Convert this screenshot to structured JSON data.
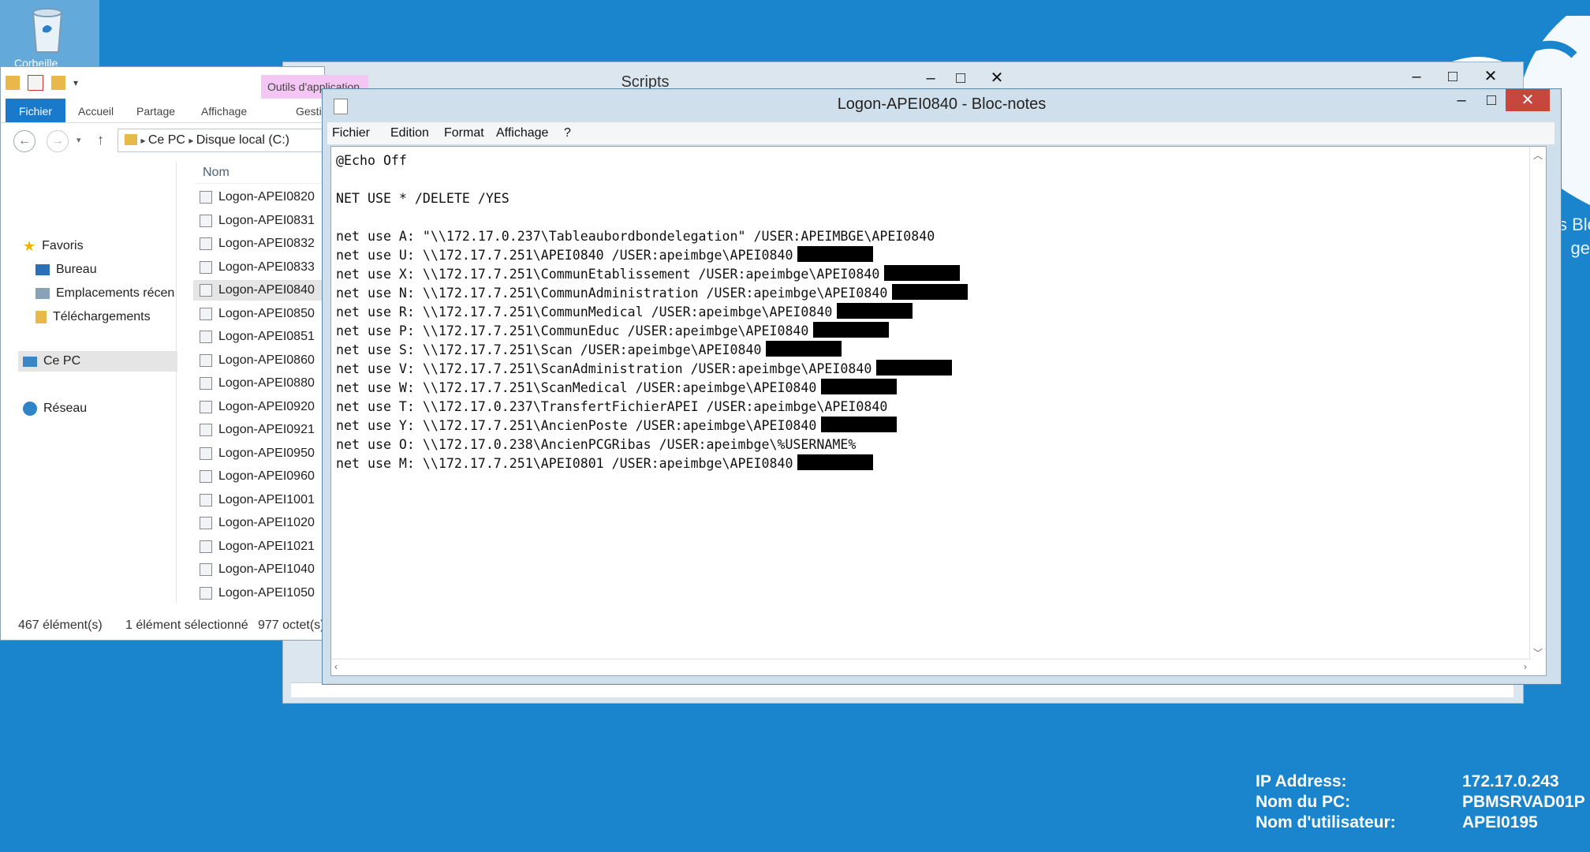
{
  "desktop": {
    "recycle_label": "Corbeille",
    "side_text": [
      "s Blo",
      "ge"
    ],
    "bginfo": [
      {
        "label": "IP Address:",
        "value": "172.17.0.243"
      },
      {
        "label": "Nom du PC:",
        "value": "PBMSRVAD01P"
      },
      {
        "label": "Nom d'utilisateur:",
        "value": "APEI0195"
      }
    ]
  },
  "explorer": {
    "contextual_tab": "Outils d'application",
    "tabs": [
      "Fichier",
      "Accueil",
      "Partage",
      "Affichage",
      "Gesti"
    ],
    "breadcrumb": [
      "Ce PC",
      "Disque local (C:)"
    ],
    "nav": {
      "favoris": "Favoris",
      "bureau": "Bureau",
      "emplacements": "Emplacements récen",
      "telechargements": "Téléchargements",
      "ce_pc": "Ce PC",
      "reseau": "Réseau"
    },
    "column_nom": "Nom",
    "files": [
      "Logon-APEI0820",
      "Logon-APEI0831",
      "Logon-APEI0832",
      "Logon-APEI0833",
      "Logon-APEI0840",
      "Logon-APEI0850",
      "Logon-APEI0851",
      "Logon-APEI0860",
      "Logon-APEI0880",
      "Logon-APEI0920",
      "Logon-APEI0921",
      "Logon-APEI0950",
      "Logon-APEI0960",
      "Logon-APEI1001",
      "Logon-APEI1020",
      "Logon-APEI1021",
      "Logon-APEI1040",
      "Logon-APEI1050"
    ],
    "selected_file": "Logon-APEI0840",
    "status": {
      "count": "467 élément(s)",
      "selection": "1 élément sélectionné",
      "size": "977 octet(s)"
    }
  },
  "scripts_window": {
    "title": "Scripts"
  },
  "notepad": {
    "title": "Logon-APEI0840 - Bloc-notes",
    "menu": [
      "Fichier",
      "Edition",
      "Format",
      "Affichage",
      "?"
    ],
    "lines": [
      {
        "text": "@Echo Off",
        "redacted": false
      },
      {
        "text": "",
        "redacted": false
      },
      {
        "text": "NET USE * /DELETE /YES",
        "redacted": false
      },
      {
        "text": "",
        "redacted": false
      },
      {
        "text": "net use A: \"\\\\172.17.0.237\\Tableaubordbondelegation\" /USER:APEIMBGE\\APEI0840",
        "redacted": false
      },
      {
        "text": "net use U: \\\\172.17.7.251\\APEI0840 /USER:apeimbge\\APEI0840",
        "redacted": true
      },
      {
        "text": "net use X: \\\\172.17.7.251\\CommunEtablissement /USER:apeimbge\\APEI0840",
        "redacted": true
      },
      {
        "text": "net use N: \\\\172.17.7.251\\CommunAdministration /USER:apeimbge\\APEI0840",
        "redacted": true
      },
      {
        "text": "net use R: \\\\172.17.7.251\\CommunMedical /USER:apeimbge\\APEI0840",
        "redacted": true
      },
      {
        "text": "net use P: \\\\172.17.7.251\\CommunEduc /USER:apeimbge\\APEI0840",
        "redacted": true
      },
      {
        "text": "net use S: \\\\172.17.7.251\\Scan /USER:apeimbge\\APEI0840",
        "redacted": true
      },
      {
        "text": "net use V: \\\\172.17.7.251\\ScanAdministration /USER:apeimbge\\APEI0840",
        "redacted": true
      },
      {
        "text": "net use W: \\\\172.17.7.251\\ScanMedical /USER:apeimbge\\APEI0840",
        "redacted": true
      },
      {
        "text": "net use T: \\\\172.17.0.237\\TransfertFichierAPEI /USER:apeimbge\\APEI0840",
        "redacted": false
      },
      {
        "text": "net use Y: \\\\172.17.7.251\\AncienPoste /USER:apeimbge\\APEI0840",
        "redacted": true
      },
      {
        "text": "net use O: \\\\172.17.0.238\\AncienPCGRibas /USER:apeimbge\\%USERNAME%",
        "redacted": false
      },
      {
        "text": "net use M: \\\\172.17.7.251\\APEI0801 /USER:apeimbge\\APEI0840",
        "redacted": true
      }
    ]
  }
}
